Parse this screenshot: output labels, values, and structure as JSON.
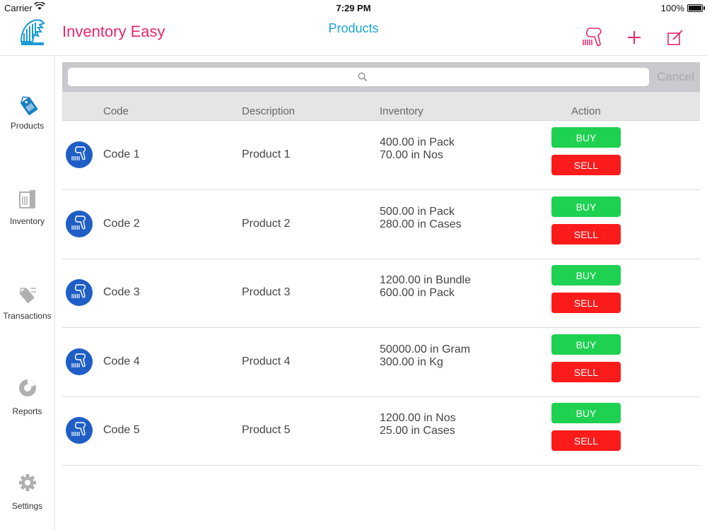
{
  "status": {
    "carrier": "Carrier",
    "time": "7:29 PM",
    "battery": "100%"
  },
  "app": {
    "title": "Inventory Easy",
    "page_title": "Products"
  },
  "search": {
    "cancel": "Cancel"
  },
  "table": {
    "headers": {
      "code": "Code",
      "description": "Description",
      "inventory": "Inventory",
      "action": "Action"
    },
    "rows": [
      {
        "code": "Code 1",
        "description": "Product 1",
        "inv1": "400.00 in Pack",
        "inv2": "70.00 in Nos",
        "buy": "BUY",
        "sell": "SELL"
      },
      {
        "code": "Code 2",
        "description": "Product 2",
        "inv1": "500.00 in Pack",
        "inv2": "280.00 in Cases",
        "buy": "BUY",
        "sell": "SELL"
      },
      {
        "code": "Code 3",
        "description": "Product 3",
        "inv1": "1200.00 in Bundle",
        "inv2": "600.00 in Pack",
        "buy": "BUY",
        "sell": "SELL"
      },
      {
        "code": "Code 4",
        "description": "Product 4",
        "inv1": "50000.00 in Gram",
        "inv2": "300.00 in Kg",
        "buy": "BUY",
        "sell": "SELL"
      },
      {
        "code": "Code 5",
        "description": "Product 5",
        "inv1": "1200.00 in Nos",
        "inv2": "25.00 in Cases",
        "buy": "BUY",
        "sell": "SELL"
      }
    ]
  },
  "sidebar": {
    "items": [
      {
        "label": "Products",
        "icon": "price-tag-icon",
        "active": true
      },
      {
        "label": "Inventory",
        "icon": "warehouse-icon",
        "active": false
      },
      {
        "label": "Transactions",
        "icon": "tags-icon",
        "active": false
      },
      {
        "label": "Reports",
        "icon": "pie-chart-icon",
        "active": false
      },
      {
        "label": "Settings",
        "icon": "gear-icon",
        "active": false
      }
    ]
  },
  "colors": {
    "brand": "#e8276d",
    "title": "#1aa7d6",
    "active_tab": "#1a7fc2",
    "inactive_tab": "#b0b0b0",
    "buy": "#1fd150",
    "sell": "#fc1b1b",
    "row_icon": "#1f5ec6"
  }
}
